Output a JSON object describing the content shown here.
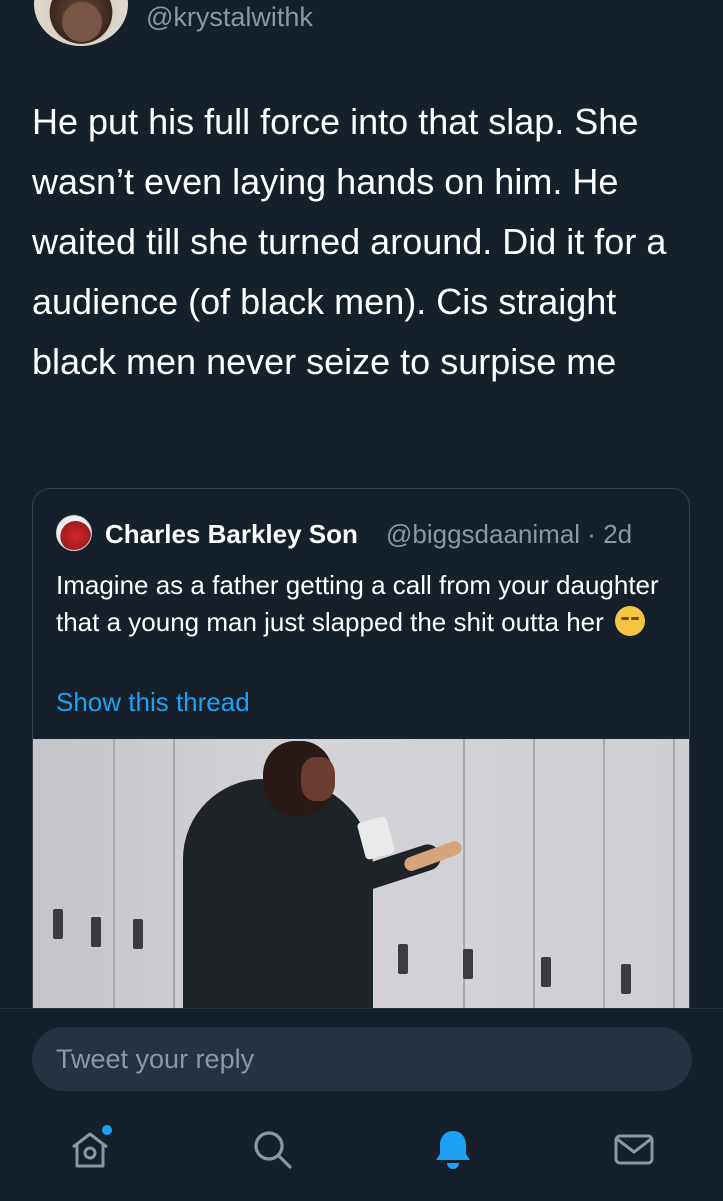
{
  "tweet": {
    "handle": "@krystalwithk",
    "text": "He put his full force into that slap. She wasn’t even laying hands on him. He waited till she turned around. Did it for a audience (of black men). Cis straight black men never seize to surpise me"
  },
  "quoted_tweet": {
    "author_name": "Charles Barkley Son",
    "handle": "@biggsdaanimal",
    "separator": "·",
    "time": "2d",
    "text": "Imagine as a father getting a call from your daughter that a young man just slapped the shit outta her",
    "emoji": "pensive-face",
    "show_thread_label": "Show this thread"
  },
  "reply": {
    "placeholder": "Tweet your reply"
  },
  "nav": {
    "items": [
      "home-icon",
      "search-icon",
      "notifications-icon",
      "messages-icon"
    ],
    "active": "notifications-icon"
  },
  "colors": {
    "background": "#15202b",
    "accent": "#1da1f2",
    "secondary_text": "#8899a6",
    "border": "#38444d"
  }
}
